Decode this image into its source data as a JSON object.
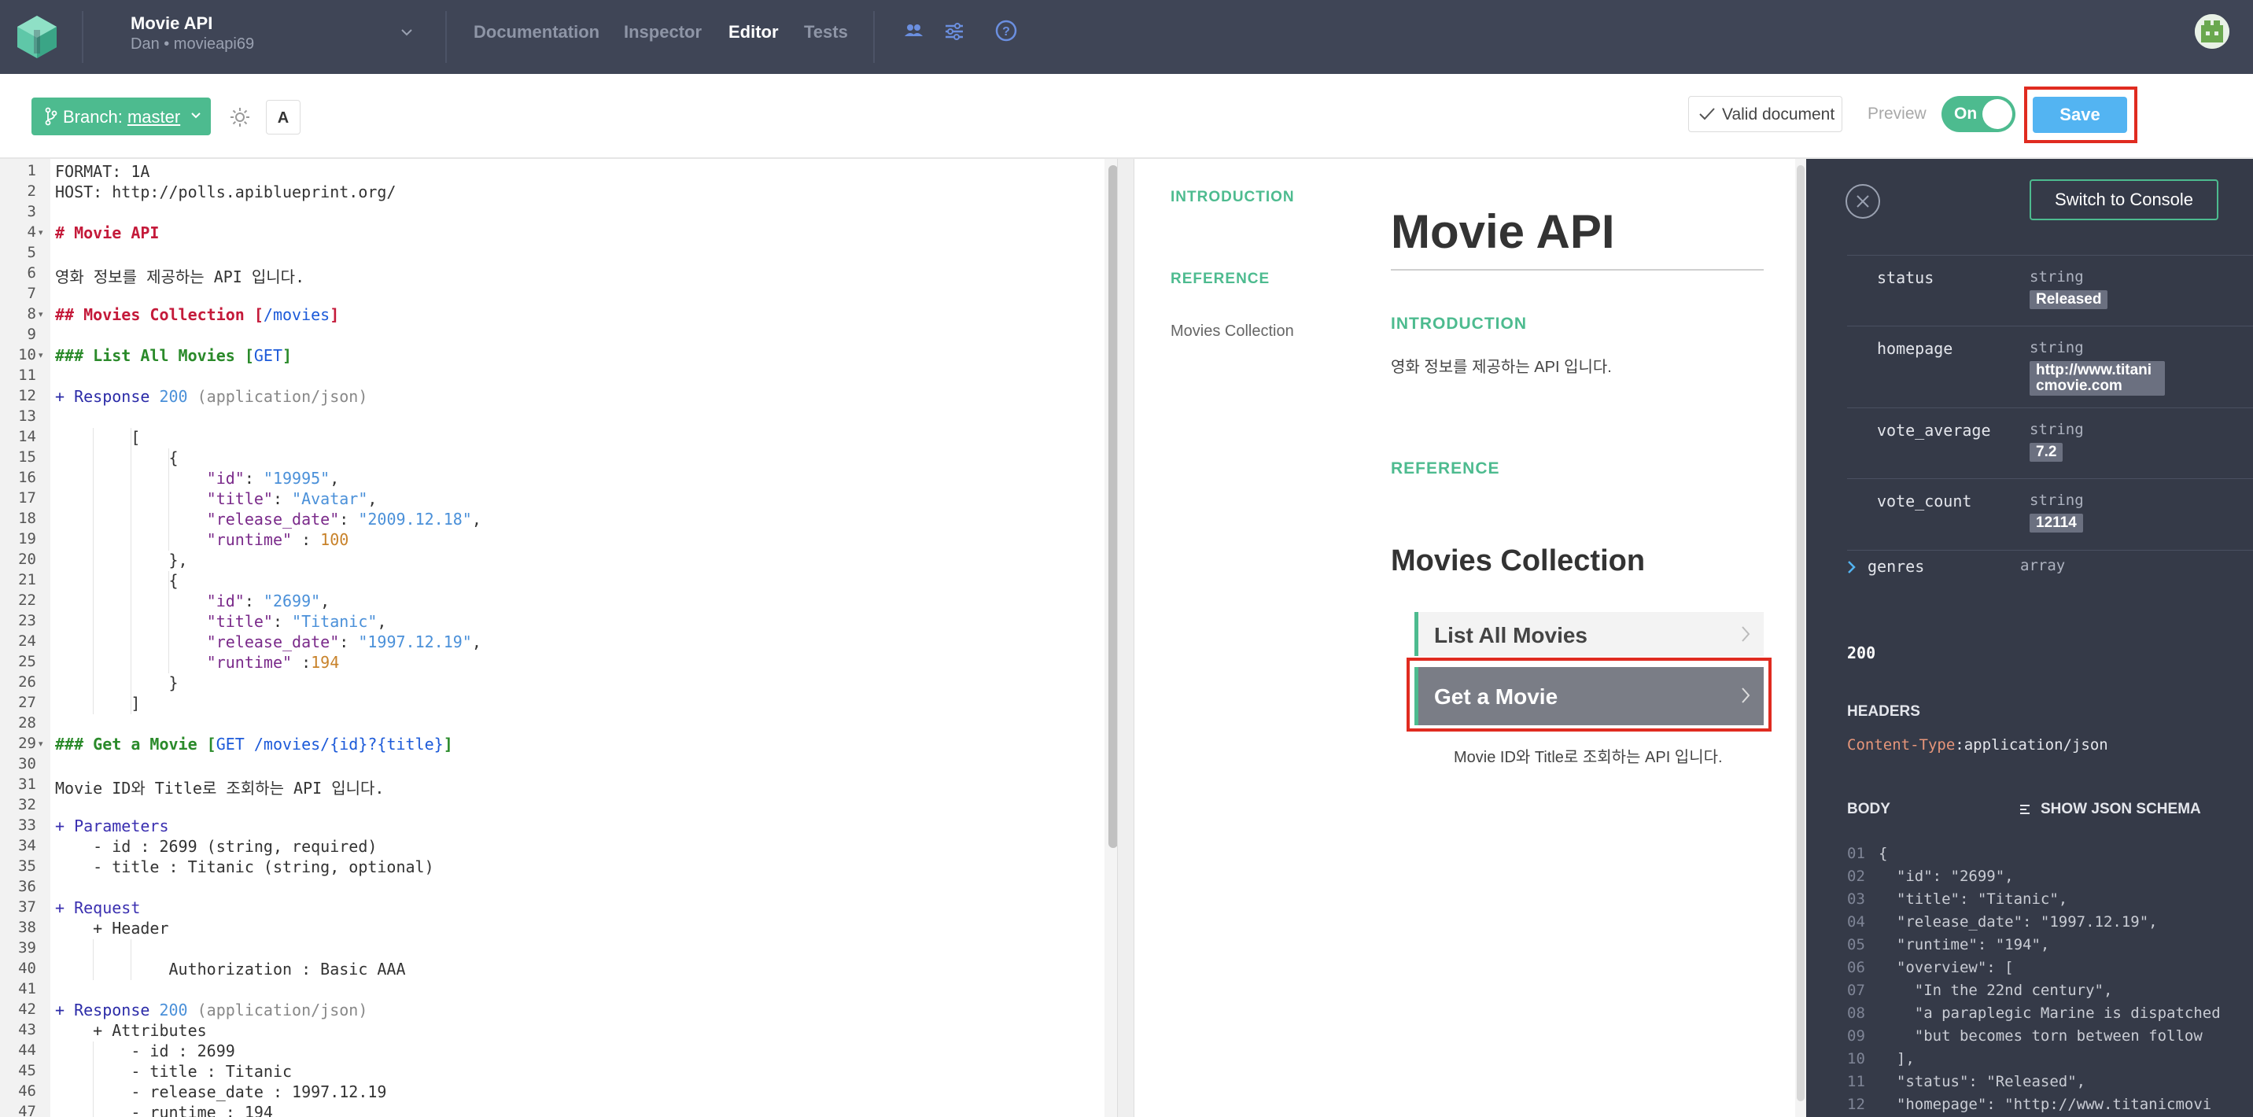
{
  "topnav": {
    "project_name": "Movie API",
    "project_sub": "Dan • movieapi69",
    "tabs": [
      "Documentation",
      "Inspector",
      "Editor",
      "Tests"
    ],
    "active_tab": "Editor",
    "icons": [
      "team-icon",
      "settings-sliders-icon",
      "help-icon"
    ]
  },
  "toolbar": {
    "branch_prefix": "Branch: ",
    "branch_name": "master",
    "font_button": "A",
    "valid_label": "Valid document",
    "preview_label": "Preview",
    "toggle_label": "On",
    "save_label": "Save"
  },
  "editor": {
    "line_count": 47,
    "fold_lines": [
      4,
      8,
      10,
      29
    ],
    "lines": [
      [
        [
          "FORMAT: 1A",
          ""
        ]
      ],
      [
        [
          "HOST: http://polls.apiblueprint.org/",
          ""
        ]
      ],
      [],
      [
        [
          "# Movie API",
          "c-red"
        ]
      ],
      [],
      [
        [
          "영화 정보를 제공하는 API 입니다.",
          ""
        ]
      ],
      [],
      [
        [
          "## Movies Collection [",
          "c-red"
        ],
        [
          "/movies",
          "c-blue"
        ],
        [
          "]",
          "c-red"
        ]
      ],
      [],
      [
        [
          "### List All Movies [",
          "c-green"
        ],
        [
          "GET",
          "c-blue"
        ],
        [
          "]",
          "c-green"
        ]
      ],
      [],
      [
        [
          "+ Response ",
          "c-navy"
        ],
        [
          "200",
          "c-str"
        ],
        [
          " (application/json)",
          "c-gray"
        ]
      ],
      [],
      [
        [
          "        [",
          ""
        ]
      ],
      [
        [
          "            {",
          ""
        ]
      ],
      [
        [
          "                \"id\"",
          "c-key"
        ],
        [
          ": ",
          ""
        ],
        [
          "\"19995\"",
          "c-str"
        ],
        [
          ",",
          ""
        ]
      ],
      [
        [
          "                \"title\"",
          "c-key"
        ],
        [
          ": ",
          ""
        ],
        [
          "\"Avatar\"",
          "c-str"
        ],
        [
          ",",
          ""
        ]
      ],
      [
        [
          "                \"release_date\"",
          "c-key"
        ],
        [
          ": ",
          ""
        ],
        [
          "\"2009.12.18\"",
          "c-str"
        ],
        [
          ",",
          ""
        ]
      ],
      [
        [
          "                \"runtime\"",
          "c-key"
        ],
        [
          " : ",
          ""
        ],
        [
          "100",
          "c-num"
        ]
      ],
      [
        [
          "            },",
          ""
        ]
      ],
      [
        [
          "            {",
          ""
        ]
      ],
      [
        [
          "                \"id\"",
          "c-key"
        ],
        [
          ": ",
          ""
        ],
        [
          "\"2699\"",
          "c-str"
        ],
        [
          ",",
          ""
        ]
      ],
      [
        [
          "                \"title\"",
          "c-key"
        ],
        [
          ": ",
          ""
        ],
        [
          "\"Titanic\"",
          "c-str"
        ],
        [
          ",",
          ""
        ]
      ],
      [
        [
          "                \"release_date\"",
          "c-key"
        ],
        [
          ": ",
          ""
        ],
        [
          "\"1997.12.19\"",
          "c-str"
        ],
        [
          ",",
          ""
        ]
      ],
      [
        [
          "                \"runtime\"",
          "c-key"
        ],
        [
          " :",
          ""
        ],
        [
          "194",
          "c-num"
        ]
      ],
      [
        [
          "            }",
          ""
        ]
      ],
      [
        [
          "        ]",
          ""
        ]
      ],
      [],
      [
        [
          "### Get a Movie [",
          "c-green"
        ],
        [
          "GET /movies/{id}?{title}",
          "c-blue"
        ],
        [
          "]",
          "c-green"
        ]
      ],
      [],
      [
        [
          "Movie ID와 Title로 조회하는 API 입니다.",
          ""
        ]
      ],
      [],
      [
        [
          "+ Parameters",
          "c-purple"
        ]
      ],
      [
        [
          "    - id : 2699 (string, required)",
          ""
        ]
      ],
      [
        [
          "    - title : Titanic (string, optional)",
          ""
        ]
      ],
      [],
      [
        [
          "+ Request",
          "c-purple"
        ]
      ],
      [
        [
          "    + Header",
          ""
        ]
      ],
      [],
      [
        [
          "            Authorization : Basic AAA",
          ""
        ]
      ],
      [],
      [
        [
          "+ Response ",
          "c-navy"
        ],
        [
          "200",
          "c-str"
        ],
        [
          " (application/json)",
          "c-gray"
        ]
      ],
      [
        [
          "    + Attributes",
          ""
        ]
      ],
      [
        [
          "        - id : 2699",
          ""
        ]
      ],
      [
        [
          "        - title : Titanic",
          ""
        ]
      ],
      [
        [
          "        - release_date : 1997.12.19",
          ""
        ]
      ],
      [
        [
          "        - runtime : 194",
          ""
        ]
      ]
    ]
  },
  "preview": {
    "toc_introduction": "INTRODUCTION",
    "toc_reference": "REFERENCE",
    "toc_item": "Movies Collection",
    "title": "Movie API",
    "intro_heading": "INTRODUCTION",
    "description": "영화 정보를 제공하는 API 입니다.",
    "reference_heading": "REFERENCE",
    "collection_title": "Movies Collection",
    "resource_list": "List All Movies",
    "resource_get": "Get a Movie",
    "resource_get_desc": "Movie ID와 Title로 조회하는 API 입니다."
  },
  "panel": {
    "switch_label": "Switch to Console",
    "attributes": [
      {
        "name": "status",
        "type": "string",
        "value": "Released"
      },
      {
        "name": "homepage",
        "type": "string",
        "value": "http://www.titanicmovie.com"
      },
      {
        "name": "vote_average",
        "type": "string",
        "value": "7.2"
      },
      {
        "name": "vote_count",
        "type": "string",
        "value": "12114"
      }
    ],
    "genres_name": "genres",
    "genres_type": "array",
    "status_code": "200",
    "headers_label": "HEADERS",
    "header_key": "Content-Type",
    "header_value": ":application/json",
    "body_label": "BODY",
    "schema_label": "SHOW JSON SCHEMA",
    "json_lines": [
      [
        "01",
        "{"
      ],
      [
        "02",
        "  \"id\": \"2699\","
      ],
      [
        "03",
        "  \"title\": \"Titanic\","
      ],
      [
        "04",
        "  \"release_date\": \"1997.12.19\","
      ],
      [
        "05",
        "  \"runtime\": \"194\","
      ],
      [
        "06",
        "  \"overview\": ["
      ],
      [
        "07",
        "    \"In the 22nd century\","
      ],
      [
        "08",
        "    \"a paraplegic Marine is dispatched"
      ],
      [
        "09",
        "    \"but becomes torn between follow"
      ],
      [
        "10",
        "  ],"
      ],
      [
        "11",
        "  \"status\": \"Released\","
      ],
      [
        "12",
        "  \"homepage\": \"http://www.titanicmovi"
      ]
    ]
  },
  "colors": {
    "nav_bg": "#3f4556",
    "accent_green": "#4dbb8f",
    "save_blue": "#53b4f2",
    "panel_bg": "#353a48",
    "highlight_red": "#e02b20"
  }
}
